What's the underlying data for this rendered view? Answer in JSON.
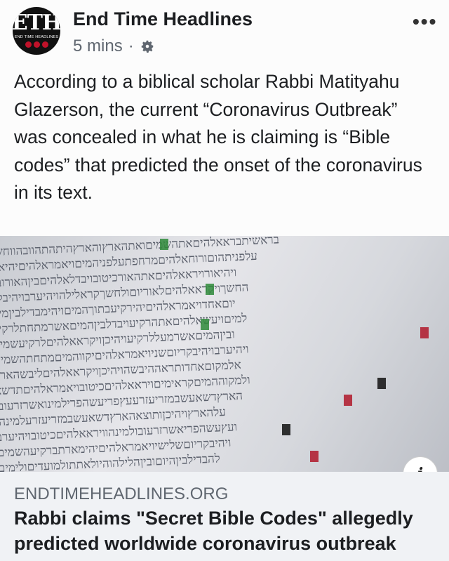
{
  "header": {
    "logo_text": "ETH",
    "logo_subtext": "END TIME HEADLINES",
    "page_name": "End Time Headlines",
    "timestamp": "5 mins",
    "separator": "·",
    "audience_icon": "gear-icon",
    "more_label": "•••"
  },
  "post": {
    "text": "According to a biblical scholar Rabbi Matityahu Glazerson, the current “Coronavirus Outbreak” was concealed in what he is claiming is “Bible codes” that predicted the onset of the coronavirus in its text."
  },
  "link_preview": {
    "domain": "ENDTIMEHEADLINES.ORG",
    "title": "Rabbi claims \"Secret Bible Codes\" allegedly predicted worldwide coronavirus outbreak",
    "info_label": "i"
  },
  "colors": {
    "accent_red": "#c0122a",
    "text": "#1c1e21",
    "meta": "#606770"
  }
}
